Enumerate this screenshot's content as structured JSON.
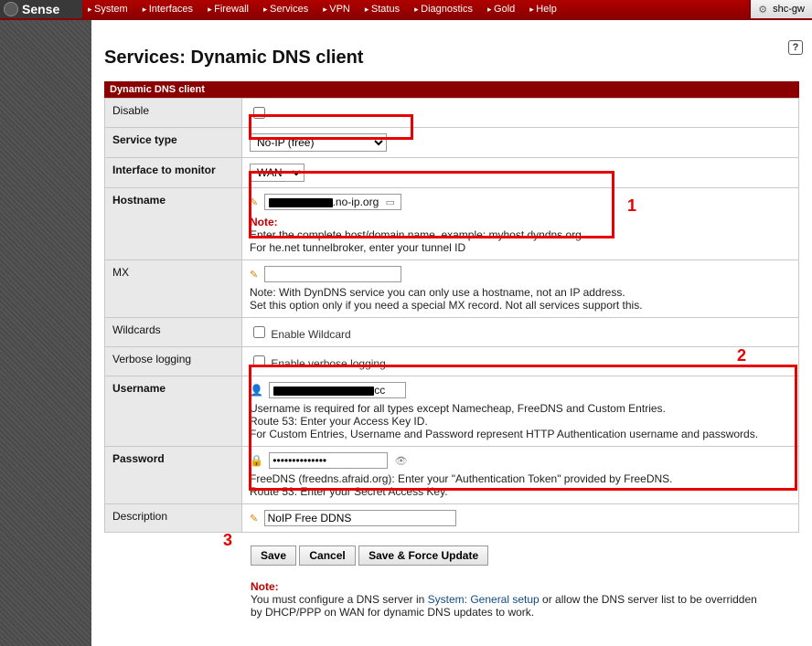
{
  "brand": "Sense",
  "host_tab": "shc-gw",
  "menu": [
    "System",
    "Interfaces",
    "Firewall",
    "Services",
    "VPN",
    "Status",
    "Diagnostics",
    "Gold",
    "Help"
  ],
  "page_title": "Services: Dynamic DNS client",
  "section_title": "Dynamic DNS client",
  "annotations": {
    "one": "1",
    "two": "2",
    "three": "3"
  },
  "rows": {
    "disable": {
      "label": "Disable"
    },
    "service_type": {
      "label": "Service type",
      "value": "No-IP (free)"
    },
    "interface": {
      "label": "Interface to monitor",
      "value": "WAN"
    },
    "hostname": {
      "label": "Hostname",
      "value_suffix": ".no-ip.org",
      "note_title": "Note:",
      "note_l1": "Enter the complete host/domain name. example: myhost.dyndns.org",
      "note_l2": "For he.net tunnelbroker, enter your tunnel ID"
    },
    "mx": {
      "label": "MX",
      "hint_l1": "Note: With DynDNS service you can only use a hostname, not an IP address.",
      "hint_l2": "Set this option only if you need a special MX record. Not all services support this."
    },
    "wildcards": {
      "label": "Wildcards",
      "chk": "Enable Wildcard"
    },
    "verbose": {
      "label": "Verbose logging",
      "chk": "Enable verbose logging"
    },
    "username": {
      "label": "Username",
      "value_suffix": "cc",
      "hint_l1": "Username is required for all types except Namecheap, FreeDNS and Custom Entries.",
      "hint_l2": "Route 53: Enter your Access Key ID.",
      "hint_l3": "For Custom Entries, Username and Password represent HTTP Authentication username and passwords."
    },
    "password": {
      "label": "Password",
      "value": "••••••••••••••",
      "hint_l1": "FreeDNS (freedns.afraid.org): Enter your \"Authentication Token\" provided by FreeDNS.",
      "hint_l2": "Route 53: Enter your Secret Access Key."
    },
    "description": {
      "label": "Description",
      "value": "NoIP Free DDNS"
    }
  },
  "buttons": {
    "save": "Save",
    "cancel": "Cancel",
    "force": "Save & Force Update"
  },
  "footer": {
    "note_title": "Note:",
    "line_a": "You must configure a DNS server in ",
    "link": "System: General setup",
    "line_b": " or allow the DNS server list to be overridden by DHCP/PPP on WAN for dynamic DNS updates to work."
  }
}
